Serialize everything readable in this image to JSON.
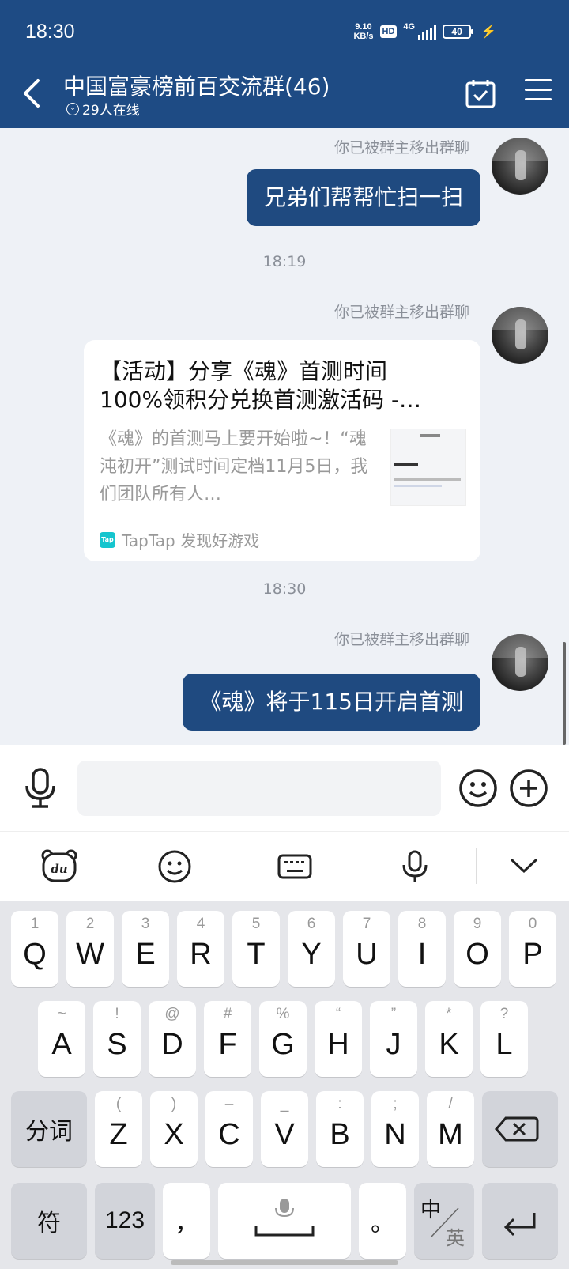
{
  "status": {
    "time": "18:30",
    "net_speed_value": "9.10",
    "net_speed_unit": "KB/s",
    "hd": "HD",
    "network": "4G",
    "battery": "40"
  },
  "header": {
    "title": "中国富豪榜前百交流群(46)",
    "online": "29人在线"
  },
  "messages": [
    {
      "note": "你已被群主移出群聊",
      "text": "兄弟们帮帮忙扫一扫"
    },
    {
      "time": "18:19"
    },
    {
      "note": "你已被群主移出群聊",
      "card": {
        "title": "【活动】分享《魂》首测时间100%领积分兑换首测激活码 -…",
        "desc": "《魂》的首测马上要开始啦~！“魂沌初开”测试时间定档11月5日，我们团队所有人…",
        "source": "TapTap 发现好游戏",
        "source_icon": "Tap"
      }
    },
    {
      "time": "18:30"
    },
    {
      "note": "你已被群主移出群聊",
      "text": "《魂》将于115日开启首测"
    }
  ],
  "input": {
    "value": "",
    "placeholder": ""
  },
  "keyboard": {
    "row1": [
      {
        "main": "Q",
        "sub": "1"
      },
      {
        "main": "W",
        "sub": "2"
      },
      {
        "main": "E",
        "sub": "3"
      },
      {
        "main": "R",
        "sub": "4"
      },
      {
        "main": "T",
        "sub": "5"
      },
      {
        "main": "Y",
        "sub": "6"
      },
      {
        "main": "U",
        "sub": "7"
      },
      {
        "main": "I",
        "sub": "8"
      },
      {
        "main": "O",
        "sub": "9"
      },
      {
        "main": "P",
        "sub": "0"
      }
    ],
    "row2": [
      {
        "main": "A",
        "sub": "~"
      },
      {
        "main": "S",
        "sub": "!"
      },
      {
        "main": "D",
        "sub": "@"
      },
      {
        "main": "F",
        "sub": "#"
      },
      {
        "main": "G",
        "sub": "%"
      },
      {
        "main": "H",
        "sub": "“"
      },
      {
        "main": "J",
        "sub": "”"
      },
      {
        "main": "K",
        "sub": "*"
      },
      {
        "main": "L",
        "sub": "?"
      }
    ],
    "row3": [
      {
        "main": "Z",
        "sub": "("
      },
      {
        "main": "X",
        "sub": ")"
      },
      {
        "main": "C",
        "sub": "–"
      },
      {
        "main": "V",
        "sub": "_"
      },
      {
        "main": "B",
        "sub": ":"
      },
      {
        "main": "N",
        "sub": ";"
      },
      {
        "main": "M",
        "sub": "/"
      }
    ],
    "segment": "分词",
    "symbols": "符",
    "numbers": "123",
    "comma": "，",
    "period": "。",
    "lang_zh": "中",
    "lang_en": "英"
  }
}
